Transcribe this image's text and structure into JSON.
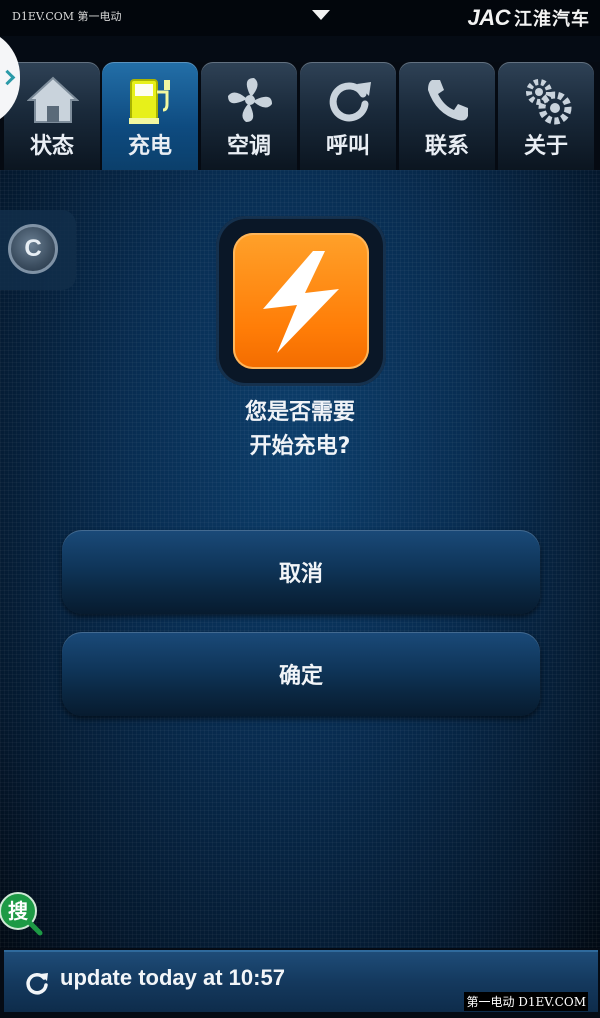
{
  "top_bar": {
    "watermark": "D1EV.COM 第一电动",
    "brand_logo": "JAC",
    "brand_name": "江淮汽车",
    "dropdown_icon": "triangle-down-icon"
  },
  "tabs": [
    {
      "label": "状态",
      "icon": "home-icon",
      "active": false
    },
    {
      "label": "充电",
      "icon": "charging-station-icon",
      "active": true
    },
    {
      "label": "空调",
      "icon": "fan-icon",
      "active": false
    },
    {
      "label": "呼叫",
      "icon": "refresh-icon",
      "active": false
    },
    {
      "label": "联系",
      "icon": "phone-icon",
      "active": false
    },
    {
      "label": "关于",
      "icon": "gears-icon",
      "active": false
    }
  ],
  "side": {
    "c_badge": "C"
  },
  "dialog": {
    "line1": "您是否需要",
    "line2": "开始充电?",
    "cancel_label": "取消",
    "confirm_label": "确定"
  },
  "search_badge": "搜",
  "footer": {
    "update_text": "update today at 10:57"
  },
  "watermark_bottom": "第一电动 D1EV.COM",
  "colors": {
    "accent_orange": "#ff8a0a",
    "active_tab": "#1a5f97",
    "charge_icon_yellow": "#e7f01a"
  }
}
